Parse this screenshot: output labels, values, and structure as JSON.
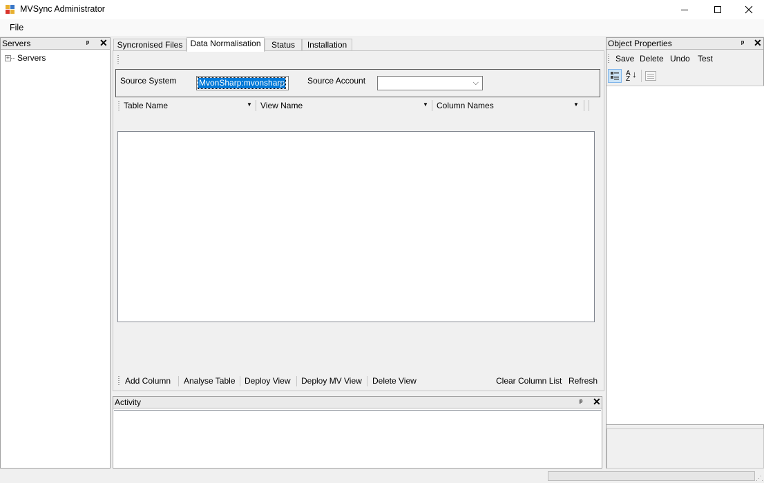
{
  "window": {
    "title": "MVSync Administrator"
  },
  "menu": {
    "file": "File"
  },
  "servers_panel": {
    "title": "Servers",
    "tree_root": "Servers"
  },
  "tabs": [
    {
      "label": "Syncronised Files",
      "active": false
    },
    {
      "label": "Data Normalisation",
      "active": true
    },
    {
      "label": "Status",
      "active": false
    },
    {
      "label": "Installation",
      "active": false
    }
  ],
  "source": {
    "system_label": "Source System",
    "system_value": "MvonSharp:mvonsharp",
    "account_label": "Source Account",
    "account_value": ""
  },
  "headers": {
    "table_name": "Table Name",
    "view_name": "View Name",
    "column_names": "Column Names"
  },
  "toolbar": {
    "add_column": "Add Column",
    "analyse_table": "Analyse Table",
    "deploy_view": "Deploy View",
    "deploy_mv_view": "Deploy MV View",
    "delete_view": "Delete View",
    "clear_column_list": "Clear Column List",
    "refresh": "Refresh"
  },
  "activity_panel": {
    "title": "Activity"
  },
  "props_panel": {
    "title": "Object Properties",
    "save": "Save",
    "delete": "Delete",
    "undo": "Undo",
    "test": "Test"
  },
  "icons": {
    "categorized": "categorized-icon",
    "alphabetical": "sort-az-icon",
    "property_pages": "property-pages-icon",
    "pin": "pin-icon",
    "close": "close-icon"
  },
  "colors": {
    "selection": "#0078d7"
  }
}
